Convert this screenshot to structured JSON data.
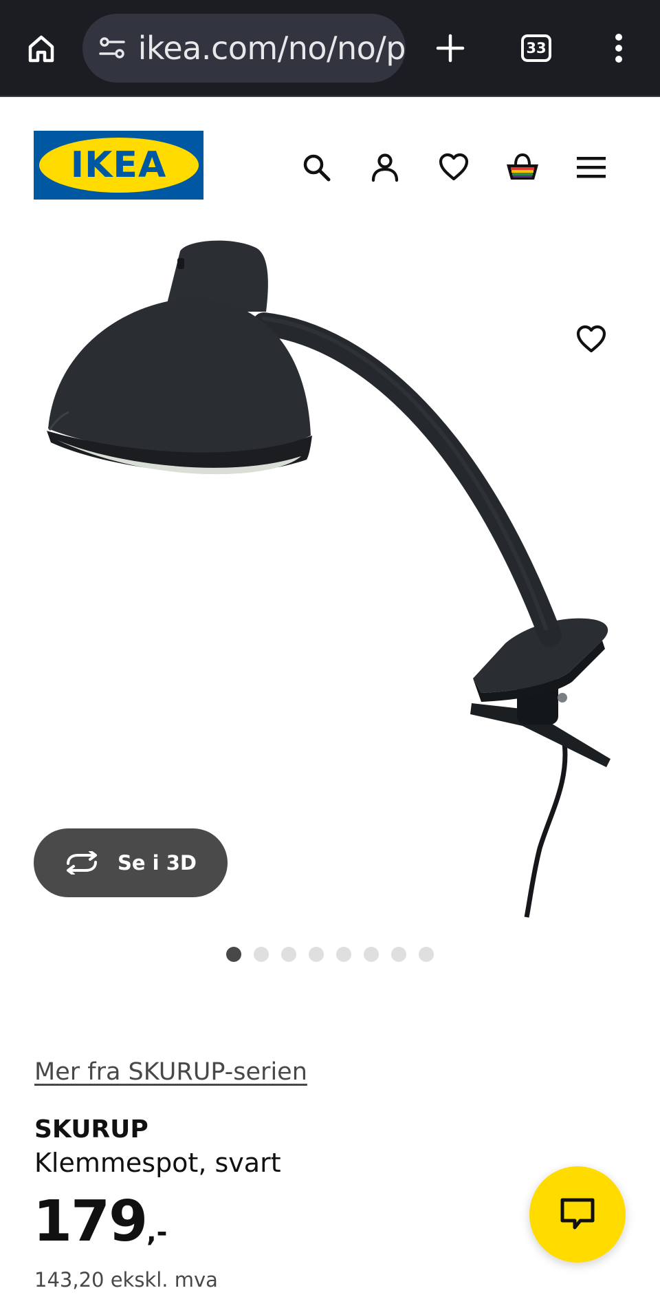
{
  "browser": {
    "url": "ikea.com/no/no/p",
    "tab_count": "33"
  },
  "header": {
    "logo_text": "IKEA"
  },
  "gallery": {
    "view_3d_label": "Se i 3D",
    "image_count": 8,
    "active_index": 0
  },
  "product": {
    "series_link": "Mer fra SKURUP-serien",
    "name": "SKURUP",
    "description": "Klemmespot, svart",
    "price": "179",
    "price_suffix": ",-",
    "price_ex_vat": "143,20 ekskl. mva"
  },
  "colors": {
    "ikea_blue": "#0058a3",
    "ikea_yellow": "#ffdb00",
    "browser_bar": "#1b1d22"
  },
  "icons": {
    "browser": [
      "home-icon",
      "site-settings-icon",
      "plus-icon",
      "tab-switcher-icon",
      "more-vert-icon"
    ],
    "header": [
      "search-icon",
      "user-icon",
      "heart-icon",
      "basket-icon",
      "hamburger-menu-icon"
    ],
    "other": [
      "favourite-heart-icon",
      "rotate-3d-icon",
      "chat-icon"
    ]
  }
}
